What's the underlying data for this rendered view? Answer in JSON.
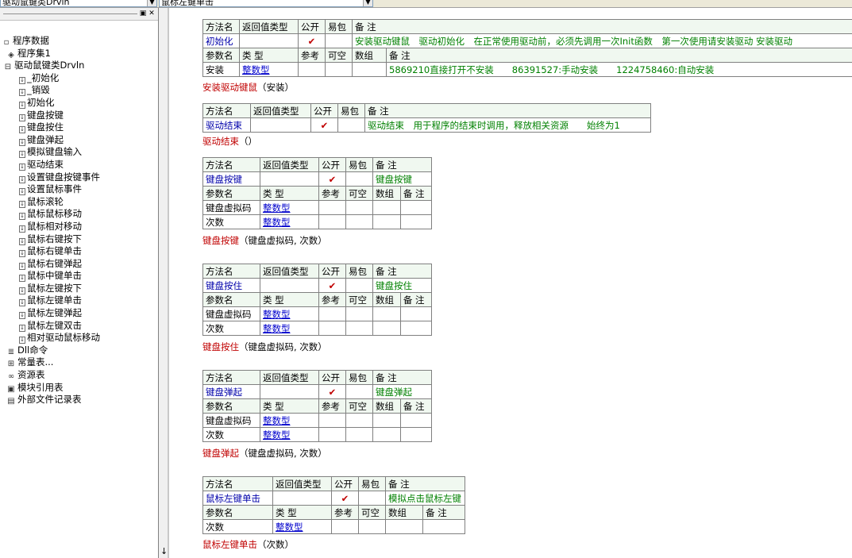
{
  "topbar": {
    "left_combo": "驱动鼠键类Drvln",
    "right_combo": "鼠标左键单击"
  },
  "tree": [
    {
      "level": "lv0",
      "icon": "▫",
      "name": "tree-root-program-data",
      "label": "程序数据"
    },
    {
      "level": "lv1",
      "icon": "◈",
      "name": "tree-program-set",
      "label": "程序集1"
    },
    {
      "level": "lv2",
      "icon": "⊟",
      "name": "tree-class-drvln",
      "label": "驱动鼠键类Drvln"
    },
    {
      "level": "lv3",
      "icon": "↓",
      "label": "_初始化"
    },
    {
      "level": "lv3",
      "icon": "↓",
      "label": "_销毁"
    },
    {
      "level": "lv3",
      "icon": "↓",
      "label": "初始化"
    },
    {
      "level": "lv3",
      "icon": "↓",
      "label": "键盘按键"
    },
    {
      "level": "lv3",
      "icon": "↓",
      "label": "键盘按住"
    },
    {
      "level": "lv3",
      "icon": "↓",
      "label": "键盘弹起"
    },
    {
      "level": "lv3",
      "icon": "↓",
      "label": "模拟键盘输入"
    },
    {
      "level": "lv3",
      "icon": "↓",
      "label": "驱动结束"
    },
    {
      "level": "lv3",
      "icon": "↓",
      "label": "设置键盘按键事件"
    },
    {
      "level": "lv3",
      "icon": "↓",
      "label": "设置鼠标事件"
    },
    {
      "level": "lv3",
      "icon": "↓",
      "label": "鼠标滚轮"
    },
    {
      "level": "lv3",
      "icon": "↓",
      "label": "鼠标鼠标移动"
    },
    {
      "level": "lv3",
      "icon": "↓",
      "label": "鼠标相对移动"
    },
    {
      "level": "lv3",
      "icon": "↓",
      "label": "鼠标右键按下"
    },
    {
      "level": "lv3",
      "icon": "↓",
      "label": "鼠标右键单击"
    },
    {
      "level": "lv3",
      "icon": "↓",
      "label": "鼠标右键弹起"
    },
    {
      "level": "lv3",
      "icon": "↓",
      "label": "鼠标中键单击"
    },
    {
      "level": "lv3",
      "icon": "↓",
      "label": "鼠标左键按下"
    },
    {
      "level": "lv3",
      "icon": "↓",
      "label": "鼠标左键单击"
    },
    {
      "level": "lv3",
      "icon": "↓",
      "label": "鼠标左键弹起"
    },
    {
      "level": "lv3",
      "icon": "↓",
      "label": "鼠标左键双击"
    },
    {
      "level": "lv3",
      "icon": "↓",
      "label": "相对驱动鼠标移动"
    },
    {
      "level": "lv1",
      "icon": "≣",
      "name": "tree-dll-commands",
      "label": "Dll命令"
    },
    {
      "level": "lv1",
      "icon": "⊞",
      "name": "tree-constants",
      "label": "常量表..."
    },
    {
      "level": "lv1",
      "icon": "∞",
      "name": "tree-resources",
      "label": "资源表"
    },
    {
      "level": "lv1",
      "icon": "▣",
      "name": "tree-module-refs",
      "label": "模块引用表"
    },
    {
      "level": "lv1",
      "icon": "▤",
      "name": "tree-external-files",
      "label": "外部文件记录表"
    }
  ],
  "headers": {
    "method": "方法名",
    "ret": "返回值类型",
    "public": "公开",
    "easy": "易包",
    "note": "备 注",
    "param": "参数名",
    "type": "类 型",
    "ref": "参考",
    "nullable": "可空",
    "array": "数组",
    "check": "✔",
    "int_type": "整数型"
  },
  "blocks": [
    {
      "method": "初始化",
      "note": "安装驱动键鼠　驱动初始化　在正常使用驱动前，必须先调用一次Init函数　第一次使用请安装驱动 安装驱动",
      "params": [
        {
          "name": "安装",
          "type": "整数型",
          "note": "5869210直接打开不安装　　86391527:手动安装　　1224758460:自动安装"
        }
      ],
      "call_fn": "安装驱动键鼠",
      "call_args": "（安装）"
    },
    {
      "method": "驱动结束",
      "note": "驱动结束　用于程序的结束时调用，释放相关资源　　始终为1",
      "params": [],
      "call_fn": "驱动结束",
      "call_args": "（）"
    },
    {
      "method": "键盘按键",
      "note": "键盘按键",
      "params": [
        {
          "name": "键盘虚拟码",
          "type": "整数型",
          "note": ""
        },
        {
          "name": "次数",
          "type": "整数型",
          "note": ""
        }
      ],
      "call_fn": "键盘按键",
      "call_args": "（键盘虚拟码, 次数）"
    },
    {
      "method": "键盘按住",
      "note": "键盘按住",
      "params": [
        {
          "name": "键盘虚拟码",
          "type": "整数型",
          "note": ""
        },
        {
          "name": "次数",
          "type": "整数型",
          "note": ""
        }
      ],
      "call_fn": "键盘按住",
      "call_args": "（键盘虚拟码, 次数）"
    },
    {
      "method": "键盘弹起",
      "note": "键盘弹起",
      "params": [
        {
          "name": "键盘虚拟码",
          "type": "整数型",
          "note": ""
        },
        {
          "name": "次数",
          "type": "整数型",
          "note": ""
        }
      ],
      "call_fn": "键盘弹起",
      "call_args": "（键盘虚拟码, 次数）"
    },
    {
      "method": "鼠标左键单击",
      "note": "模拟点击鼠标左键",
      "params": [
        {
          "name": "次数",
          "type": "整数型",
          "note": ""
        }
      ],
      "call_fn": "鼠标左键单击",
      "call_args": "（次数）"
    }
  ]
}
